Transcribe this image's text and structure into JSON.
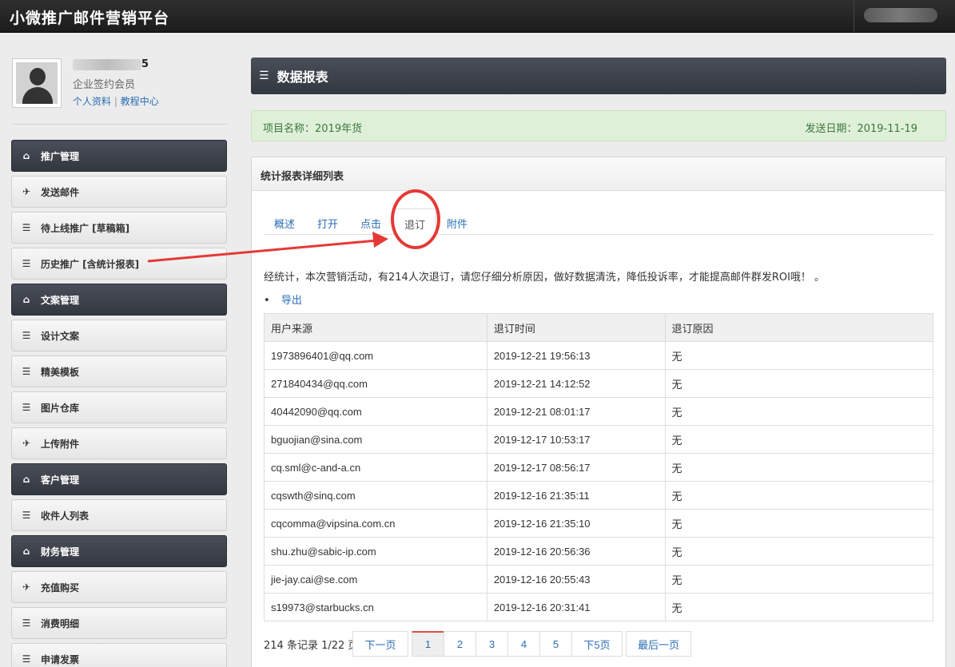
{
  "app": {
    "title": "小微推广邮件营销平台"
  },
  "profile": {
    "username_suffix": "5",
    "member_type": "企业签约会员",
    "link_profile": "个人资料",
    "link_sep": "|",
    "link_tutorial": "教程中心"
  },
  "sidebar": {
    "items": [
      {
        "label": "推广管理",
        "kind": "header",
        "icon": "home-icon"
      },
      {
        "label": "发送邮件",
        "kind": "sub",
        "icon": "plane-icon"
      },
      {
        "label": "待上线推广 [草稿箱]",
        "kind": "sub",
        "icon": "list-icon"
      },
      {
        "label": "历史推广 [含统计报表]",
        "kind": "sub",
        "icon": "list-icon"
      },
      {
        "label": "文案管理",
        "kind": "header",
        "icon": "home-icon"
      },
      {
        "label": "设计文案",
        "kind": "sub",
        "icon": "list-icon"
      },
      {
        "label": "精美模板",
        "kind": "sub",
        "icon": "list-icon"
      },
      {
        "label": "图片仓库",
        "kind": "sub",
        "icon": "list-icon"
      },
      {
        "label": "上传附件",
        "kind": "sub",
        "icon": "plane-icon"
      },
      {
        "label": "客户管理",
        "kind": "header",
        "icon": "home-icon"
      },
      {
        "label": "收件人列表",
        "kind": "sub",
        "icon": "list-icon"
      },
      {
        "label": "财务管理",
        "kind": "header",
        "icon": "home-icon"
      },
      {
        "label": "充值购买",
        "kind": "sub",
        "icon": "plane-icon"
      },
      {
        "label": "消费明细",
        "kind": "sub",
        "icon": "list-icon"
      },
      {
        "label": "申请发票",
        "kind": "sub",
        "icon": "list-icon"
      }
    ]
  },
  "main": {
    "title": "数据报表",
    "project_label": "项目名称：2019年货",
    "send_date_label": "发送日期：2019-11-19",
    "panel_title": "统计报表详细列表",
    "tabs": [
      {
        "label": "概述",
        "active": false
      },
      {
        "label": "打开",
        "active": false
      },
      {
        "label": "点击",
        "active": false
      },
      {
        "label": "退订",
        "active": true
      },
      {
        "label": "附件",
        "active": false
      }
    ],
    "summary": "经统计，本次营销活动，有214人次退订，请您仔细分析原因，做好数据清洗，降低投诉率，才能提高邮件群发ROI哦！ 。",
    "export_label": "导出"
  },
  "table": {
    "headers": [
      "用户来源",
      "退订时间",
      "退订原因"
    ],
    "rows": [
      [
        "1973896401@qq.com",
        "2019-12-21 19:56:13",
        "无"
      ],
      [
        "271840434@qq.com",
        "2019-12-21 14:12:52",
        "无"
      ],
      [
        "40442090@qq.com",
        "2019-12-21 08:01:17",
        "无"
      ],
      [
        "bguojian@sina.com",
        "2019-12-17 10:53:17",
        "无"
      ],
      [
        "cq.sml@c-and-a.cn",
        "2019-12-17 08:56:17",
        "无"
      ],
      [
        "cqswth@sinq.com",
        "2019-12-16 21:35:11",
        "无"
      ],
      [
        "cqcomma@vipsina.com.cn",
        "2019-12-16 21:35:10",
        "无"
      ],
      [
        "shu.zhu@sabic-ip.com",
        "2019-12-16 20:56:36",
        "无"
      ],
      [
        "jie-jay.cai@se.com",
        "2019-12-16 20:55:43",
        "无"
      ],
      [
        "s19973@starbucks.cn",
        "2019-12-16 20:31:41",
        "无"
      ]
    ]
  },
  "pagination": {
    "info": "214 条记录 1/22 页",
    "next": "下一页",
    "pages": [
      "1",
      "2",
      "3",
      "4",
      "5"
    ],
    "next5": "下5页",
    "last": "最后一页",
    "current": "1"
  },
  "colors": {
    "header_dark": "#3b3f48",
    "link": "#2a6db5",
    "annotation": "#e53935",
    "success_bg": "#dff0d8"
  }
}
